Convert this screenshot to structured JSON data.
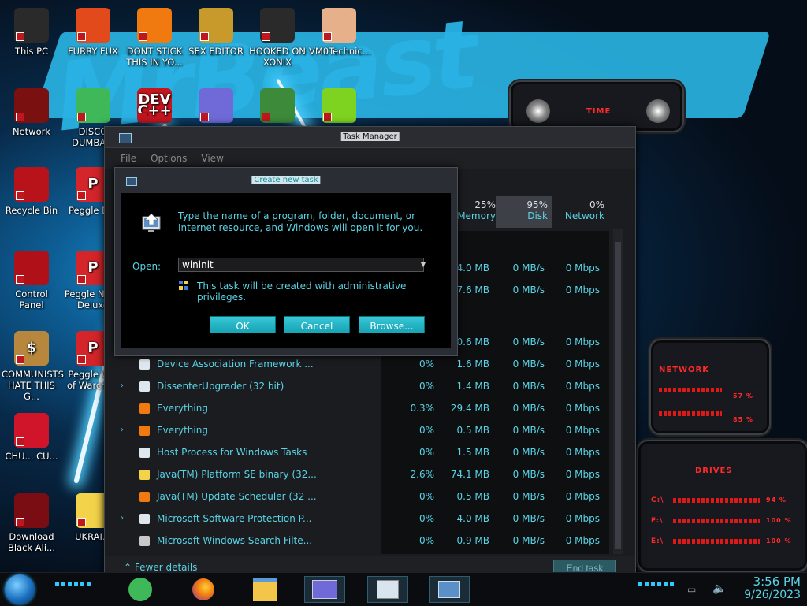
{
  "wallpaper": {
    "text": "MrBeast"
  },
  "desktop_icons": [
    {
      "label": "This PC",
      "color": "#2a2a2a"
    },
    {
      "label": "FURRY FUX",
      "color": "#e24a1c"
    },
    {
      "label": "DONT STICK THIS IN YO...",
      "color": "#f07a10"
    },
    {
      "label": "SEX EDITOR",
      "color": "#c89a2c"
    },
    {
      "label": "HOOKED ON XONIX",
      "color": "#2a2a2a"
    },
    {
      "label": "VM0Technic...",
      "color": "#e6b08a"
    },
    {
      "label": "Network",
      "color": "#7a1010"
    },
    {
      "label": "DISCO DUMBA...",
      "color": "#3fb85a"
    },
    {
      "label": "",
      "color": "#c4161e",
      "glyph": "DEV C++"
    },
    {
      "label": "",
      "color": "#6f6ad8"
    },
    {
      "label": "",
      "color": "#3c8a3a"
    },
    {
      "label": "",
      "color": "#7ed321"
    },
    {
      "label": "Recycle Bin",
      "color": "#b8121a"
    },
    {
      "label": "Peggle D...",
      "color": "#d3252a",
      "glyph": "P"
    },
    {
      "label": "Control Panel",
      "color": "#b01018"
    },
    {
      "label": "Peggle Nig... Deluxe",
      "color": "#d3252a",
      "glyph": "P"
    },
    {
      "label": "COMMUNISTS HATE THIS G...",
      "color": "#b7873e",
      "glyph": "$"
    },
    {
      "label": "Peggle W... of Warcra...",
      "color": "#d3252a",
      "glyph": "P"
    },
    {
      "label": "CHU... CU...",
      "color": "#d0142a"
    },
    {
      "label": "Download Black Ali...",
      "color": "#7a0c14"
    },
    {
      "label": "UKRAI...",
      "color": "#f3d34a"
    }
  ],
  "widgets": {
    "time_label": "TIME",
    "network_label": "NETWORK",
    "network_pct": "57 %",
    "network_pct2": "85 %",
    "drives_label": "DRIVES",
    "drives": [
      {
        "name": "C:\\",
        "pct": "94 %"
      },
      {
        "name": "F:\\",
        "pct": "100 %"
      },
      {
        "name": "E:\\",
        "pct": "100 %"
      }
    ]
  },
  "taskmanager": {
    "title": "Task Manager",
    "menu": [
      "File",
      "Options",
      "View"
    ],
    "columns": [
      {
        "pct": "25%",
        "label": "Memory"
      },
      {
        "pct": "95%",
        "label": "Disk"
      },
      {
        "pct": "0%",
        "label": "Network"
      }
    ],
    "upper_rows": [
      {
        "mem": "4.0 MB",
        "disk": "0 MB/s",
        "net": "0 Mbps"
      },
      {
        "mem": "7.6 MB",
        "disk": "0 MB/s",
        "net": "0 Mbps"
      },
      {
        "mem": "0.6 MB",
        "disk": "0 MB/s",
        "net": "0 Mbps"
      }
    ],
    "rows": [
      {
        "expand": false,
        "icon": "window-icon",
        "icon_color": "#dfe7ee",
        "name": "Device Association Framework ...",
        "cpu": "0%",
        "mem": "1.6 MB",
        "disk": "0 MB/s",
        "net": "0 Mbps"
      },
      {
        "expand": true,
        "icon": "window-icon",
        "icon_color": "#dfe7ee",
        "name": "DissenterUpgrader (32 bit)",
        "cpu": "0%",
        "mem": "1.4 MB",
        "disk": "0 MB/s",
        "net": "0 Mbps"
      },
      {
        "expand": false,
        "icon": "search-icon",
        "icon_color": "#f07a10",
        "name": "Everything",
        "cpu": "0.3%",
        "mem": "29.4 MB",
        "disk": "0 MB/s",
        "net": "0 Mbps"
      },
      {
        "expand": true,
        "icon": "search-icon",
        "icon_color": "#f07a10",
        "name": "Everything",
        "cpu": "0%",
        "mem": "0.5 MB",
        "disk": "0 MB/s",
        "net": "0 Mbps"
      },
      {
        "expand": false,
        "icon": "window-icon",
        "icon_color": "#dfe7ee",
        "name": "Host Process for Windows Tasks",
        "cpu": "0%",
        "mem": "1.5 MB",
        "disk": "0 MB/s",
        "net": "0 Mbps"
      },
      {
        "expand": false,
        "icon": "star-icon",
        "icon_color": "#f3d34a",
        "name": "Java(TM) Platform SE binary (32...",
        "cpu": "2.6%",
        "mem": "74.1 MB",
        "disk": "0 MB/s",
        "net": "0 Mbps"
      },
      {
        "expand": false,
        "icon": "java-icon",
        "icon_color": "#f07a10",
        "name": "Java(TM) Update Scheduler (32 ...",
        "cpu": "0%",
        "mem": "0.5 MB",
        "disk": "0 MB/s",
        "net": "0 Mbps"
      },
      {
        "expand": true,
        "icon": "window-icon",
        "icon_color": "#dfe7ee",
        "name": "Microsoft Software Protection P...",
        "cpu": "0%",
        "mem": "4.0 MB",
        "disk": "0 MB/s",
        "net": "0 Mbps"
      },
      {
        "expand": false,
        "icon": "user-icon",
        "icon_color": "#c8c8c8",
        "name": "Microsoft Windows Search Filte...",
        "cpu": "0%",
        "mem": "0.9 MB",
        "disk": "0 MB/s",
        "net": "0 Mbps"
      }
    ],
    "fewer_details": "Fewer details",
    "end_task": "End task"
  },
  "run_dialog": {
    "title": "Create new task",
    "description": "Type the name of a program, folder, document, or Internet resource, and Windows will open it for you.",
    "open_label": "Open:",
    "input_value": "wininit",
    "admin_note": "This task will be created with administrative privileges.",
    "ok": "OK",
    "cancel": "Cancel",
    "browse": "Browse..."
  },
  "taskbar": {
    "time": "3:56 PM",
    "date": "9/26/2023",
    "accent": "#30c8ff"
  }
}
